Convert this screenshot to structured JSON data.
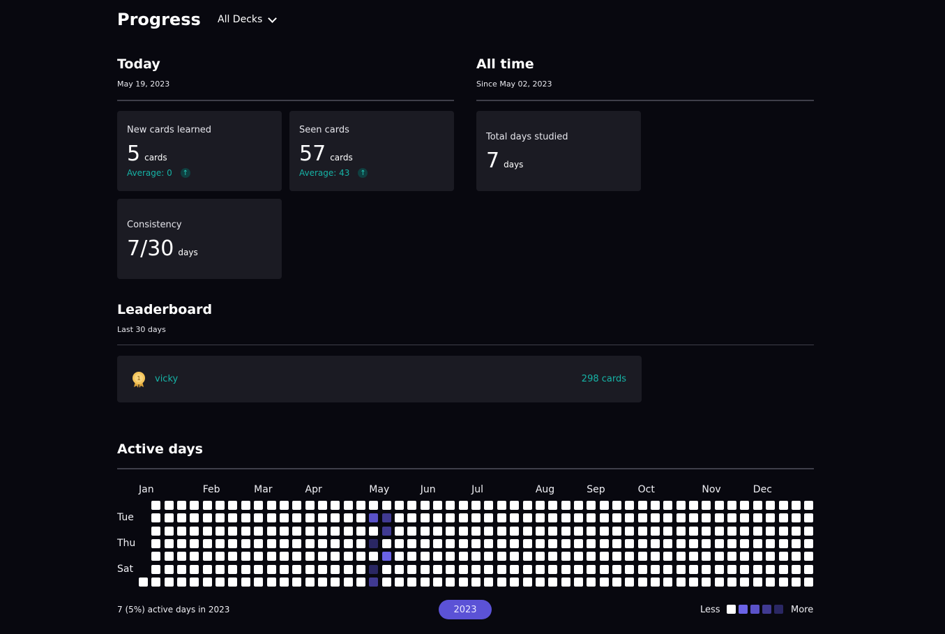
{
  "header": {
    "title": "Progress",
    "deck_selector": "All Decks"
  },
  "today": {
    "title": "Today",
    "date": "May 19, 2023",
    "cards": [
      {
        "label": "New cards learned",
        "value": "5",
        "unit": "cards",
        "average": "Average: 0"
      },
      {
        "label": "Seen cards",
        "value": "57",
        "unit": "cards",
        "average": "Average: 43"
      }
    ],
    "consistency": {
      "label": "Consistency",
      "value": "7/30",
      "unit": "days"
    }
  },
  "all_time": {
    "title": "All time",
    "since": "Since May 02, 2023",
    "total": {
      "label": "Total days studied",
      "value": "7",
      "unit": "days"
    }
  },
  "leaderboard": {
    "title": "Leaderboard",
    "period": "Last 30 days",
    "entries": [
      {
        "rank": "1",
        "name": "vicky",
        "score": "298 cards"
      }
    ]
  },
  "active_days": {
    "title": "Active days",
    "months": [
      "Jan",
      "Feb",
      "Mar",
      "Apr",
      "May",
      "Jun",
      "Jul",
      "Aug",
      "Sep",
      "Oct",
      "Nov",
      "Dec"
    ],
    "day_labels": [
      "Tue",
      "Thu",
      "Sat"
    ],
    "summary": "7 (5%) active days in 2023",
    "year": "2023",
    "legend_less": "Less",
    "legend_more": "More",
    "active": [
      {
        "date": "2023-05-02",
        "level": 2
      },
      {
        "date": "2023-05-04",
        "level": 4
      },
      {
        "date": "2023-05-06",
        "level": 4
      },
      {
        "date": "2023-05-07",
        "level": 3
      },
      {
        "date": "2023-05-09",
        "level": 3
      },
      {
        "date": "2023-05-10",
        "level": 3
      },
      {
        "date": "2023-05-12",
        "level": 1
      }
    ],
    "colors": [
      "#ffffff",
      "#6b63e6",
      "#5a52c8",
      "#403a92",
      "#2a2763"
    ]
  }
}
